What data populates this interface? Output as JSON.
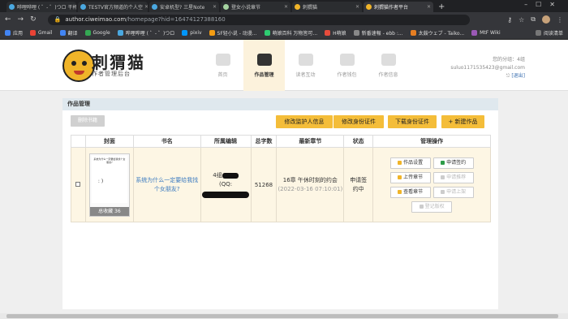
{
  "browser": {
    "tabs": [
      {
        "title": "哗哩哗哩 ( ゜- ゜)つロ 干杯",
        "color": "#4aa8e0",
        "active": false
      },
      {
        "title": "TESTV官方频道的个人空",
        "color": "#4aa8e0",
        "active": false
      },
      {
        "title": "安卓机型? 三星Note",
        "color": "#4aa8e0",
        "active": false
      },
      {
        "title": "登女小说章节",
        "color": "#a5d3a0",
        "active": false
      },
      {
        "title": "刺猬猫",
        "color": "#f0b429",
        "active": false
      },
      {
        "title": "刺猬猫作者平台",
        "color": "#f0b429",
        "active": true
      }
    ],
    "url_host": "author.ciweimao.com",
    "url_path": "/homepage?hid=1647412738816​0",
    "bookmarks": [
      "应用",
      "Gmail",
      "翻译",
      "Google",
      "哗哩哗哩 ( ゜- ゜)つロ",
      "pixiv",
      "SF轻小说 - 动漫...",
      "萌娘百科 万物皆可...",
      "H萌娘",
      "新番速報 - ebb :...",
      "太鼓ウェブ - Taiko...",
      "MtF Wiki"
    ],
    "reading_list": "阅读清单"
  },
  "site": {
    "logo_title": "刺猬猫",
    "logo_subtitle": "作者管理后台",
    "nav": [
      {
        "label": "首页",
        "icon": "home-icon",
        "active": false
      },
      {
        "label": "作品管理",
        "icon": "book-icon",
        "active": true
      },
      {
        "label": "读者互动",
        "icon": "paw-icon",
        "active": false
      },
      {
        "label": "作者钱包",
        "icon": "video-icon",
        "active": false
      },
      {
        "label": "作者信息",
        "icon": "idcard-icon",
        "active": false
      }
    ],
    "user": {
      "group_label": "您的分组：4组",
      "email": "suluo1171535423@gmail.com",
      "logout": "[退出]"
    }
  },
  "works": {
    "title": "作品管理",
    "delete_button": "删除书籍",
    "buttons": {
      "guardian": "修改监护人信息",
      "identity": "修改身份证件",
      "download_identity": "下载身份证件",
      "new_work": "新建作品"
    },
    "table": {
      "headers": [
        "",
        "封面",
        "书名",
        "所属编辑",
        "总字数",
        "最新章节",
        "状态",
        "管理操作"
      ],
      "row": {
        "cover_text": "系统为什么一定要给我找个女朋友?",
        "cover_mark": ": )",
        "favorites": "总收藏 36",
        "book_title": "系统为什么一定要给我找个女朋友?",
        "editor_line1": "4组",
        "editor_line2": "(QQ:",
        "word_count": "51268",
        "chapter_title": "16章 午休时刻的约会",
        "chapter_time": "(2022-03-16 07:10:01)",
        "status": "申请签约中",
        "ops": {
          "settings": "作品设置",
          "apply_sign": "申请签约",
          "upload": "上传章节",
          "apply_recommend": "申请推荐",
          "view": "查看章节",
          "apply_shelf": "申请上架",
          "copyright": "登记版权"
        }
      }
    }
  }
}
